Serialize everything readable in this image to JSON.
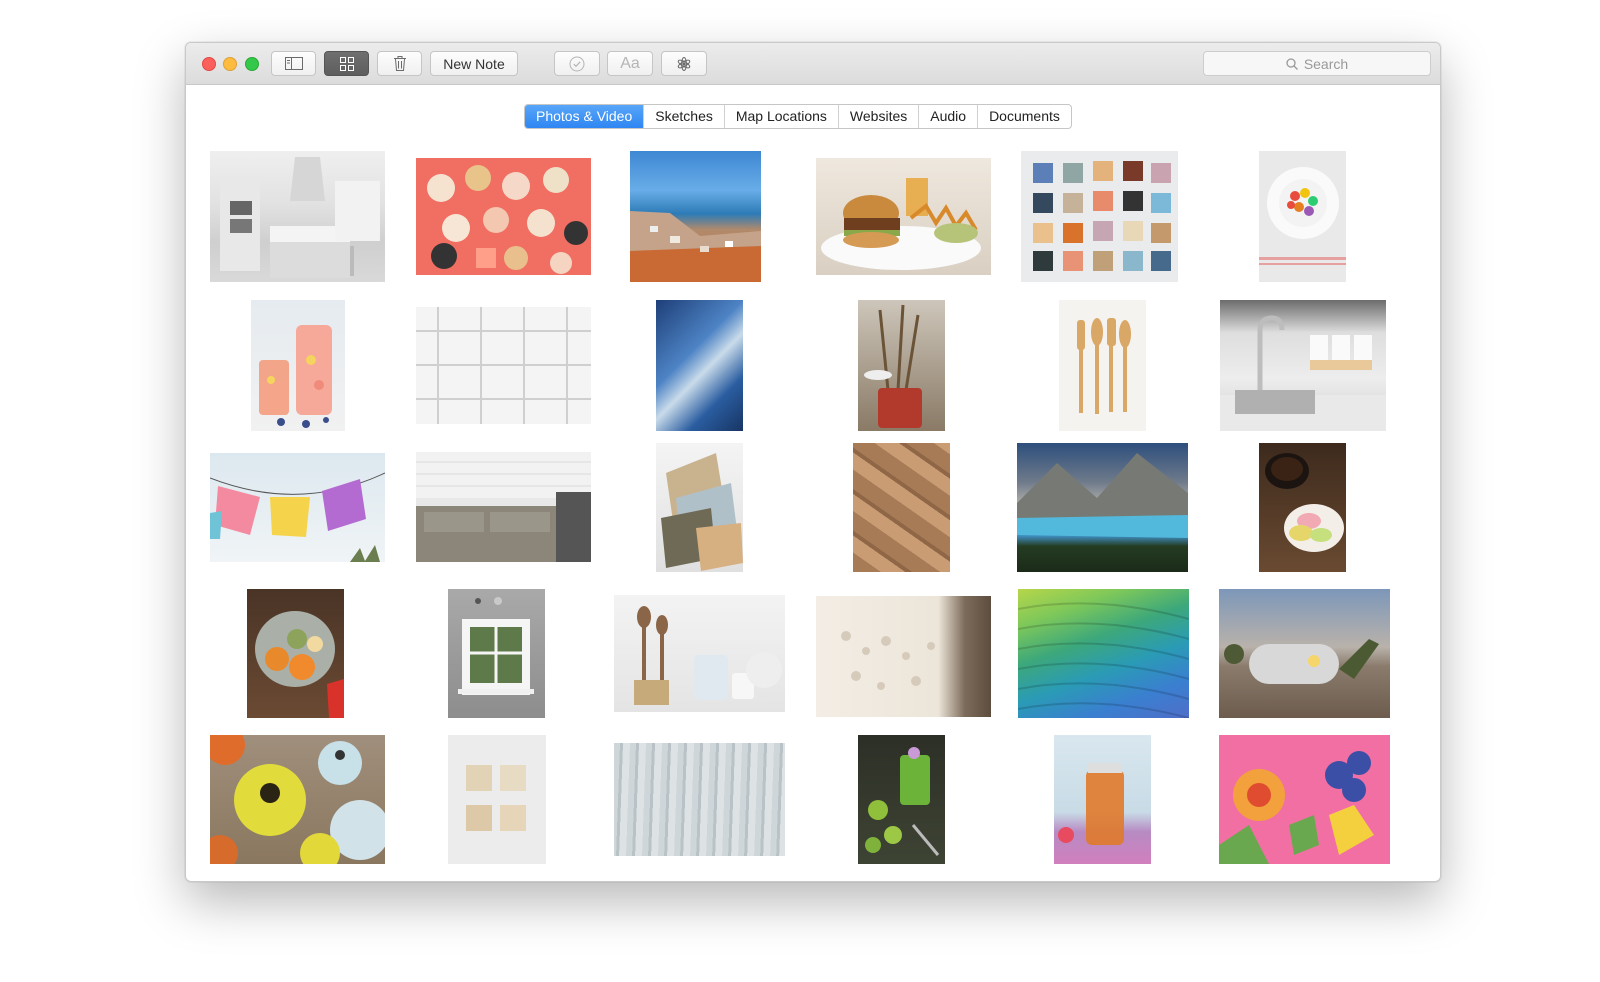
{
  "toolbar": {
    "new_note_label": "New Note",
    "format_label": "Aa",
    "search_placeholder": "Search",
    "window_controls": [
      "close",
      "minimize",
      "zoom"
    ]
  },
  "tabs": [
    {
      "label": "Photos & Video",
      "selected": true
    },
    {
      "label": "Sketches",
      "selected": false
    },
    {
      "label": "Map Locations",
      "selected": false
    },
    {
      "label": "Websites",
      "selected": false
    },
    {
      "label": "Audio",
      "selected": false
    },
    {
      "label": "Documents",
      "selected": false
    }
  ],
  "accent_color": "#2f86f2",
  "gallery": [
    [
      "white-kitchen-photo",
      "cupcakes-photo",
      "coastal-town-photo",
      "burger-and-fries-photo",
      "color-swatches-photo",
      "candy-plate-photo"
    ],
    [
      "pink-lemonade-photo",
      "white-tiles-photo",
      "blue-fabric-photo",
      "cooking-utensils-crock-photo",
      "wooden-spoons-photo",
      "kitchen-sink-photo"
    ],
    [
      "papel-picado-banner-photo",
      "kitchen-counter-photo",
      "fabric-samples-photo",
      "wood-planks-photo",
      "mountain-lake-photo",
      "coffee-macarons-photo"
    ],
    [
      "autumn-vegetables-photo",
      "kitchen-window-photo",
      "wooden-spoons-kettle-photo",
      "lace-cloth-photo",
      "rainbow-fabric-photo",
      "airstream-trailer-photo"
    ],
    [
      "ceramic-vases-photo",
      "fabric-swatches-photo",
      "weathered-wood-photo",
      "green-smoothie-photo",
      "iced-tea-jar-photo",
      "fruit-oilcloth-photo"
    ]
  ]
}
